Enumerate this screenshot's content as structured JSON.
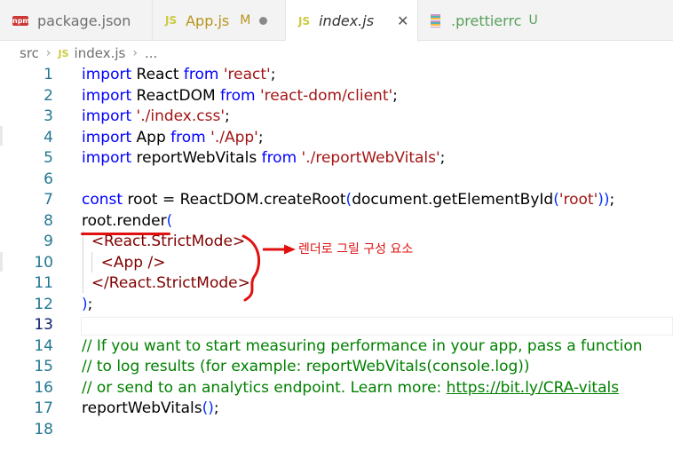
{
  "tabs": [
    {
      "icon": "npm-icon",
      "icon_label": "npm",
      "label": "package.json",
      "active": false
    },
    {
      "icon": "js-icon",
      "icon_label": "JS",
      "label": "App.js",
      "flag": "M",
      "dirty": true,
      "active": false
    },
    {
      "icon": "js-icon",
      "icon_label": "JS",
      "label": "index.js",
      "active": true
    },
    {
      "icon": "prettier-icon",
      "label": ".prettierrc",
      "flag": "U",
      "active": false
    }
  ],
  "breadcrumb": {
    "folder": "src",
    "file_icon": "JS",
    "file": "index.js",
    "more": "..."
  },
  "editor": {
    "current_line": 13,
    "lines": [
      {
        "n": "1",
        "tokens": [
          [
            "kw",
            "import"
          ],
          [
            "t",
            " React "
          ],
          [
            "kw",
            "from"
          ],
          [
            "t",
            " "
          ],
          [
            "str",
            "'react'"
          ],
          [
            "t",
            ";"
          ]
        ]
      },
      {
        "n": "2",
        "tokens": [
          [
            "kw",
            "import"
          ],
          [
            "t",
            " ReactDOM "
          ],
          [
            "kw",
            "from"
          ],
          [
            "t",
            " "
          ],
          [
            "str",
            "'react-dom/client'"
          ],
          [
            "t",
            ";"
          ]
        ]
      },
      {
        "n": "3",
        "tokens": [
          [
            "kw",
            "import"
          ],
          [
            "t",
            " "
          ],
          [
            "str",
            "'./index.css'"
          ],
          [
            "t",
            ";"
          ]
        ]
      },
      {
        "n": "4",
        "tokens": [
          [
            "kw",
            "import"
          ],
          [
            "t",
            " App "
          ],
          [
            "kw",
            "from"
          ],
          [
            "t",
            " "
          ],
          [
            "str",
            "'./App'"
          ],
          [
            "t",
            ";"
          ]
        ]
      },
      {
        "n": "5",
        "tokens": [
          [
            "kw",
            "import"
          ],
          [
            "t",
            " reportWebVitals "
          ],
          [
            "kw",
            "from"
          ],
          [
            "t",
            " "
          ],
          [
            "str",
            "'./reportWebVitals'"
          ],
          [
            "t",
            ";"
          ]
        ]
      },
      {
        "n": "6",
        "tokens": []
      },
      {
        "n": "7",
        "tokens": [
          [
            "kw",
            "const"
          ],
          [
            "t",
            " root = ReactDOM.createRoot"
          ],
          [
            "pn",
            "("
          ],
          [
            "t",
            "document.getElementById"
          ],
          [
            "pn",
            "("
          ],
          [
            "str",
            "'root'"
          ],
          [
            "pn",
            "))"
          ],
          [
            "t",
            ";"
          ]
        ]
      },
      {
        "n": "8",
        "tokens": [
          [
            "t",
            "root.render"
          ],
          [
            "pn",
            "("
          ]
        ]
      },
      {
        "n": "9",
        "tokens": [
          [
            "t",
            "  "
          ],
          [
            "tag",
            "<React.StrictMode>"
          ]
        ]
      },
      {
        "n": "10",
        "tokens": [
          [
            "t",
            "    "
          ],
          [
            "tag",
            "<App />"
          ]
        ]
      },
      {
        "n": "11",
        "tokens": [
          [
            "t",
            "  "
          ],
          [
            "tag",
            "</React.StrictMode>"
          ]
        ]
      },
      {
        "n": "12",
        "tokens": [
          [
            "pn",
            ")"
          ],
          [
            "t",
            ";"
          ]
        ]
      },
      {
        "n": "13",
        "tokens": []
      },
      {
        "n": "14",
        "tokens": [
          [
            "cm",
            "// If you want to start measuring performance in your app, pass a function"
          ]
        ]
      },
      {
        "n": "15",
        "tokens": [
          [
            "cm",
            "// to log results (for example: reportWebVitals(console.log))"
          ]
        ]
      },
      {
        "n": "16",
        "tokens": [
          [
            "cm",
            "// or send to an analytics endpoint. Learn more: "
          ],
          [
            "link",
            "https://bit.ly/CRA-vitals"
          ]
        ]
      },
      {
        "n": "17",
        "tokens": [
          [
            "t",
            "reportWebVitals"
          ],
          [
            "pn",
            "()"
          ],
          [
            "t",
            ";"
          ]
        ]
      },
      {
        "n": "18",
        "tokens": []
      }
    ]
  },
  "annotation": {
    "text": "렌더로 그릴 구성 요소",
    "color": "#e01010"
  },
  "colors": {
    "keyword": "#0000ff",
    "string": "#a31515",
    "tag": "#800000",
    "comment": "#008000",
    "line_number": "#237893",
    "annotation": "#e01010"
  }
}
